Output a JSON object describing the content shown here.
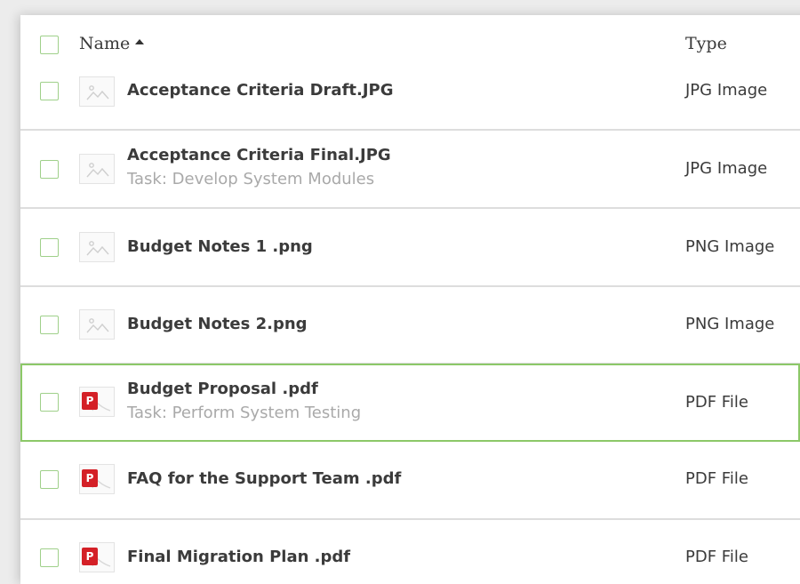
{
  "header": {
    "name_label": "Name",
    "type_label": "Type",
    "sort_icon": "sort-ascending-icon"
  },
  "colors": {
    "checkbox_border": "#9fd08a",
    "selected_border": "#8cc868",
    "pdf_badge": "#d42027"
  },
  "files": [
    {
      "name": "Acceptance Criteria Draft.JPG",
      "task": "",
      "type": "JPG Image",
      "icon": "image-file-icon"
    },
    {
      "name": "Acceptance Criteria Final.JPG",
      "task": "Task: Develop System Modules",
      "type": "JPG Image",
      "icon": "image-file-icon"
    },
    {
      "name": "Budget Notes 1 .png",
      "task": "",
      "type": "PNG Image",
      "icon": "image-file-icon"
    },
    {
      "name": "Budget Notes 2.png",
      "task": "",
      "type": "PNG Image",
      "icon": "image-file-icon"
    },
    {
      "name": "Budget Proposal .pdf",
      "task": "Task: Perform System Testing",
      "type": "PDF File",
      "icon": "pdf-file-icon",
      "pdf_badge_letter": "P"
    },
    {
      "name": "FAQ for the Support Team .pdf",
      "task": "",
      "type": "PDF File",
      "icon": "pdf-file-icon",
      "pdf_badge_letter": "P"
    },
    {
      "name": "Final Migration Plan .pdf",
      "task": "",
      "type": "PDF File",
      "icon": "pdf-file-icon",
      "pdf_badge_letter": "P"
    }
  ]
}
